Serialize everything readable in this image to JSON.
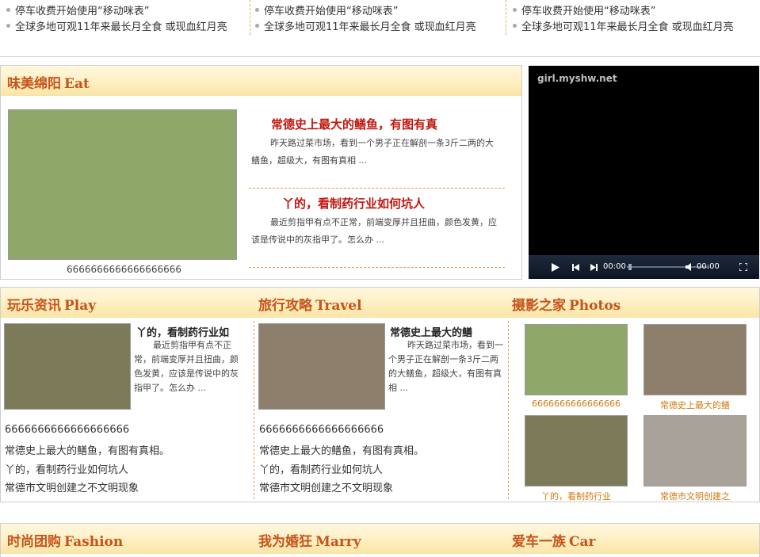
{
  "top_strip": {
    "columns": [
      {
        "item1": "停车收费开始使用“移动咪表”",
        "item2": "全球多地可观11年来最长月全食 或现血红月亮"
      },
      {
        "item1": "停车收费开始使用“移动咪表”",
        "item2": "全球多地可观11年来最长月全食 或现血红月亮"
      },
      {
        "item1": "停车收费开始使用“移动咪表”",
        "item2": "全球多地可观11年来最长月全食 或现血红月亮"
      }
    ]
  },
  "eat": {
    "title_cn": "味美绵阳",
    "title_en": "Eat",
    "image_caption": "6666666666666666666",
    "articles": [
      {
        "title": "常德史上最大的鳝鱼，有图有真",
        "summary": "昨天路过菜市场，看到一个男子正在解剖一条3斤二两的大鳝鱼，超级大，有图有真相 ..."
      },
      {
        "title": "丫的，看制药行业如何坑人",
        "summary": "最近剪指甲有点不正常，前端变厚并且扭曲，颜色发黄，应该是传说中的灰指甲了。怎么办 ..."
      }
    ]
  },
  "video": {
    "watermark": "girl.myshw.net",
    "time_current": "00:00",
    "time_total": "00:00"
  },
  "play": {
    "title_cn": "玩乐资讯",
    "title_en": "Play",
    "feature_title": "丫的，看制药行业如",
    "feature_summary": "最近剪指甲有点不正常，前端变厚并且扭曲，颜色发黄，应该是传说中的灰指甲了。怎么办 ...",
    "list": [
      "6666666666666666666",
      "常德史上最大的鳝鱼，有图有真相。",
      "丫的，看制药行业如何坑人",
      "常德市文明创建之不文明现象"
    ]
  },
  "travel": {
    "title_cn": "旅行攻略",
    "title_en": "Travel",
    "feature_title": "常德史上最大的鳝",
    "feature_summary": "昨天路过菜市场，看到一个男子正在解剖一条3斤二两的大鳝鱼，超级大，有图有真相 ...",
    "list": [
      "6666666666666666666",
      "常德史上最大的鳝鱼，有图有真相。",
      "丫的，看制药行业如何坑人",
      "常德市文明创建之不文明现象"
    ]
  },
  "photos": {
    "title_cn": "摄影之家",
    "title_en": "Photos",
    "items": [
      {
        "caption": "6666666666666666"
      },
      {
        "caption": "常德史上最大的鳝"
      },
      {
        "caption": "丫的，看制药行业"
      },
      {
        "caption": "常德市文明创建之"
      }
    ]
  },
  "bottom": {
    "fashion": {
      "title_cn": "时尚团购",
      "title_en": "Fashion"
    },
    "marry": {
      "title_cn": "我为婚狂",
      "title_en": "Marry"
    },
    "car": {
      "title_cn": "爱车一族",
      "title_en": "Car"
    }
  },
  "colors": {
    "accent": "#c6531a",
    "headline": "#c0160f",
    "photo_caption": "#d07a12",
    "dash": "#e0a050"
  }
}
